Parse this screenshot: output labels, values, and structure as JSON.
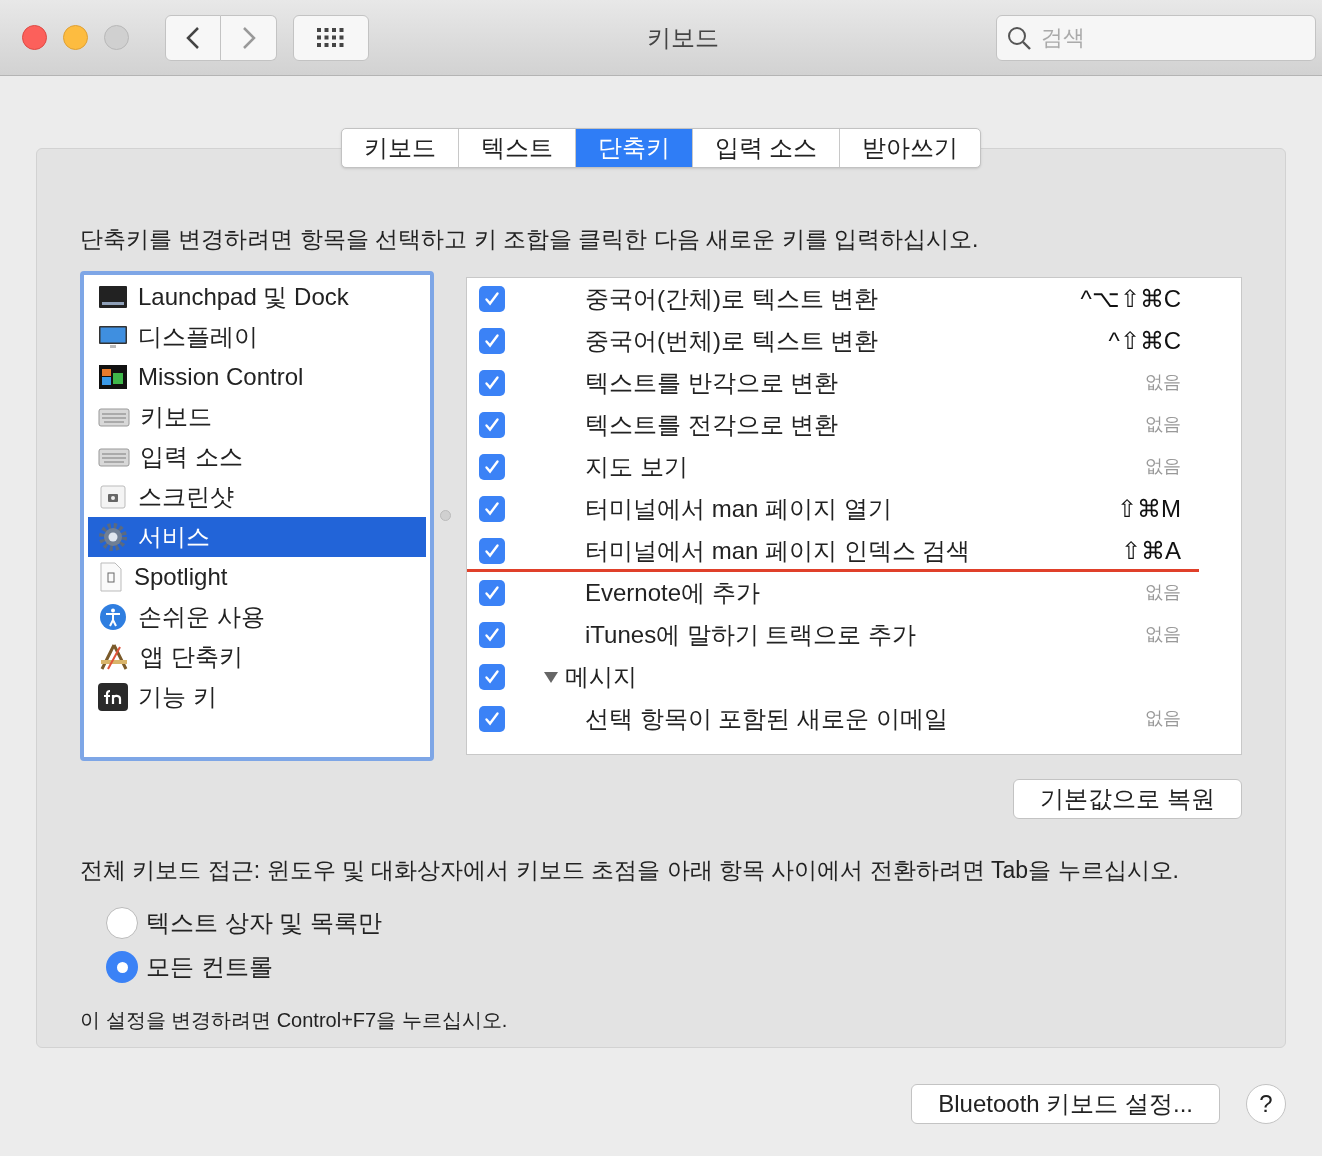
{
  "window": {
    "title": "키보드",
    "search": {
      "placeholder": "검색"
    }
  },
  "tabs": [
    {
      "label": "키보드",
      "selected": false
    },
    {
      "label": "텍스트",
      "selected": false
    },
    {
      "label": "단축키",
      "selected": true
    },
    {
      "label": "입력 소스",
      "selected": false
    },
    {
      "label": "받아쓰기",
      "selected": false
    }
  ],
  "instruction": "단축키를 변경하려면 항목을 선택하고 키 조합을 클릭한 다음 새로운 키를 입력하십시오.",
  "categories": [
    {
      "label": "Launchpad 및 Dock",
      "selected": false
    },
    {
      "label": "디스플레이",
      "selected": false
    },
    {
      "label": "Mission Control",
      "selected": false
    },
    {
      "label": "키보드",
      "selected": false
    },
    {
      "label": "입력 소스",
      "selected": false
    },
    {
      "label": "스크린샷",
      "selected": false
    },
    {
      "label": "서비스",
      "selected": true
    },
    {
      "label": "Spotlight",
      "selected": false
    },
    {
      "label": "손쉬운 사용",
      "selected": false
    },
    {
      "label": "앱 단축키",
      "selected": false
    },
    {
      "label": "기능 키",
      "selected": false
    }
  ],
  "shortcuts": [
    {
      "label": "중국어(간체)로 텍스트 변환",
      "shortcut": "^⌥⇧⌘C",
      "checked": true,
      "marked": false
    },
    {
      "label": "중국어(번체)로 텍스트 변환",
      "shortcut": "^⇧⌘C",
      "checked": true,
      "marked": false
    },
    {
      "label": "텍스트를 반각으로 변환",
      "shortcut": "없음",
      "checked": true,
      "marked": false
    },
    {
      "label": "텍스트를 전각으로 변환",
      "shortcut": "없음",
      "checked": true,
      "marked": false
    },
    {
      "label": "지도 보기",
      "shortcut": "없음",
      "checked": true,
      "marked": false
    },
    {
      "label": "터미널에서 man 페이지 열기",
      "shortcut": "⇧⌘M",
      "checked": true,
      "marked": false
    },
    {
      "label": "터미널에서 man 페이지 인덱스 검색",
      "shortcut": "⇧⌘A",
      "checked": true,
      "marked": true
    },
    {
      "label": "Evernote에 추가",
      "shortcut": "없음",
      "checked": true,
      "marked": false
    },
    {
      "label": "iTunes에 말하기 트랙으로 추가",
      "shortcut": "없음",
      "checked": true,
      "marked": false
    },
    {
      "label": "메시지",
      "checked": true,
      "expanded": true,
      "children": [
        {
          "label": "선택 항목이 포함된 새로운 이메일",
          "shortcut": "없음",
          "checked": true,
          "marked": false
        }
      ]
    }
  ],
  "restore_button": "기본값으로 복원",
  "full_keyboard_access": "전체 키보드 접근: 윈도우 및 대화상자에서 키보드 초점을 아래 항목 사이에서 전환하려면 Tab을 누르십시오.",
  "access_options": [
    {
      "label": "텍스트 상자 및 목록만",
      "selected": false
    },
    {
      "label": "모든 컨트롤",
      "selected": true
    }
  ],
  "access_hint": "이 설정을 변경하려면 Control+F7을 누르십시오.",
  "bluetooth_button": "Bluetooth 키보드 설정...",
  "help_button": "?"
}
